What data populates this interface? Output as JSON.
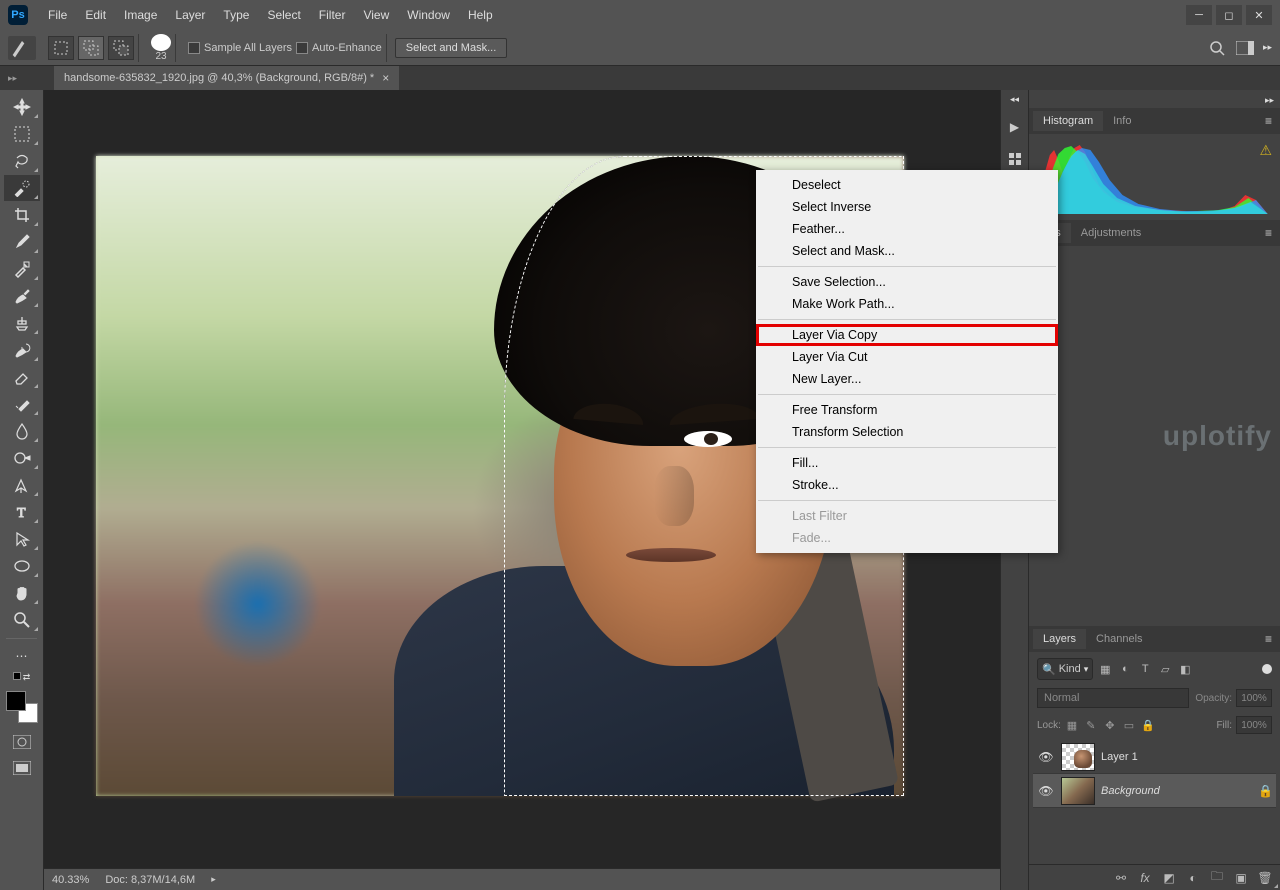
{
  "menubar": [
    "File",
    "Edit",
    "Image",
    "Layer",
    "Type",
    "Select",
    "Filter",
    "View",
    "Window",
    "Help"
  ],
  "options": {
    "brush_size": "23",
    "sample_all_layers": "Sample All Layers",
    "auto_enhance": "Auto-Enhance",
    "select_and_mask": "Select and Mask..."
  },
  "document": {
    "tab_title": "handsome-635832_1920.jpg @ 40,3% (Background, RGB/8#) *"
  },
  "context_menu": {
    "items": [
      {
        "label": "Deselect"
      },
      {
        "label": "Select Inverse"
      },
      {
        "label": "Feather..."
      },
      {
        "label": "Select and Mask..."
      },
      {
        "sep": true
      },
      {
        "label": "Save Selection..."
      },
      {
        "label": "Make Work Path..."
      },
      {
        "sep": true
      },
      {
        "label": "Layer Via Copy",
        "highlight": true
      },
      {
        "label": "Layer Via Cut"
      },
      {
        "label": "New Layer..."
      },
      {
        "sep": true
      },
      {
        "label": "Free Transform"
      },
      {
        "label": "Transform Selection"
      },
      {
        "sep": true
      },
      {
        "label": "Fill..."
      },
      {
        "label": "Stroke..."
      },
      {
        "sep": true
      },
      {
        "label": "Last Filter",
        "disabled": true
      },
      {
        "label": "Fade...",
        "disabled": true
      }
    ]
  },
  "right_panels": {
    "histogram_tab": "Histogram",
    "info_tab": "Info",
    "libraries_tab": "ries",
    "adjustments_tab": "Adjustments",
    "watermark": "uplotify",
    "layers_tab": "Layers",
    "channels_tab": "Channels"
  },
  "layers_panel": {
    "kind_label": "Kind",
    "blend_mode": "Normal",
    "opacity_label": "Opacity:",
    "opacity_val": "100%",
    "lock_label": "Lock:",
    "fill_label": "Fill:",
    "fill_val": "100%",
    "layers": [
      {
        "name": "Layer 1",
        "thumb": "checker"
      },
      {
        "name": "Background",
        "thumb": "bg",
        "locked": true,
        "bg": true
      }
    ]
  },
  "status": {
    "zoom": "40.33%",
    "doc_size": "Doc: 8,37M/14,6M"
  }
}
